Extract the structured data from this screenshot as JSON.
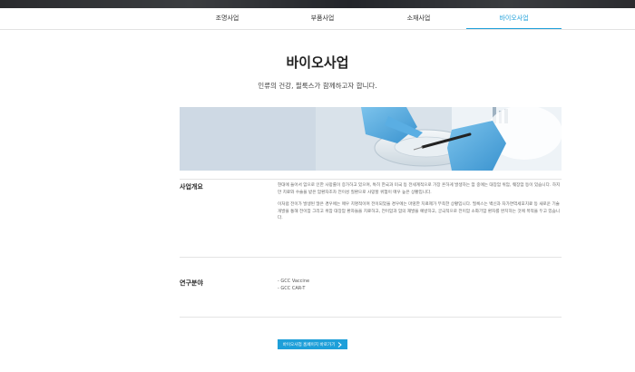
{
  "nav": {
    "items": [
      {
        "label": "조명사업",
        "active": false
      },
      {
        "label": "부품사업",
        "active": false
      },
      {
        "label": "소재사업",
        "active": false
      },
      {
        "label": "바이오사업",
        "active": true
      }
    ],
    "active_color": "#1e9fd9"
  },
  "page": {
    "title": "바이오사업",
    "subtitle": "인류의 건강, 필룩스가 함께하고자 합니다."
  },
  "sections": [
    {
      "label": "사업개요",
      "paragraphs": [
        "현대에 들어서 암으로 인한 사망률이 증가하고 있으며, 특히 한국과 미국 등 전세계적으로 가장 흔하게 발생하는 암 중에는 대장암 위암, 췌장암 등이 있습니다. 하지만 치료와 수술을 받은 암환자조차 전이성 질환으로 사망할 위험이 매우 높은 상황입니다.",
        "이처럼 전이가 발생된 많은 경우에는 매우 치명적이며 전이되었을 경우에는 마땅한 치료제가 부족한 상황입니다. 필룩스는 백신과 자가면역세포치료 등 새로운 기술 개발을 통해 전이암 그리고 위암 대장암 환자들을 치료하고, 전이암과 암의 재발을 예방하고, 궁극적으로 전이암 소화기암 환자를 완치하는 것에 목적을 두고 있습니다."
      ]
    },
    {
      "label": "연구분야",
      "items": [
        "- GCC Vaccine",
        "- GCC CAR-T"
      ]
    }
  ],
  "cta": {
    "label": "바이오사업 홈페이지 바로가기",
    "color": "#1e9fd9",
    "icon": "chevron-right-icon"
  },
  "hero": {
    "icon": "lab-gloves-pipette-photo"
  }
}
